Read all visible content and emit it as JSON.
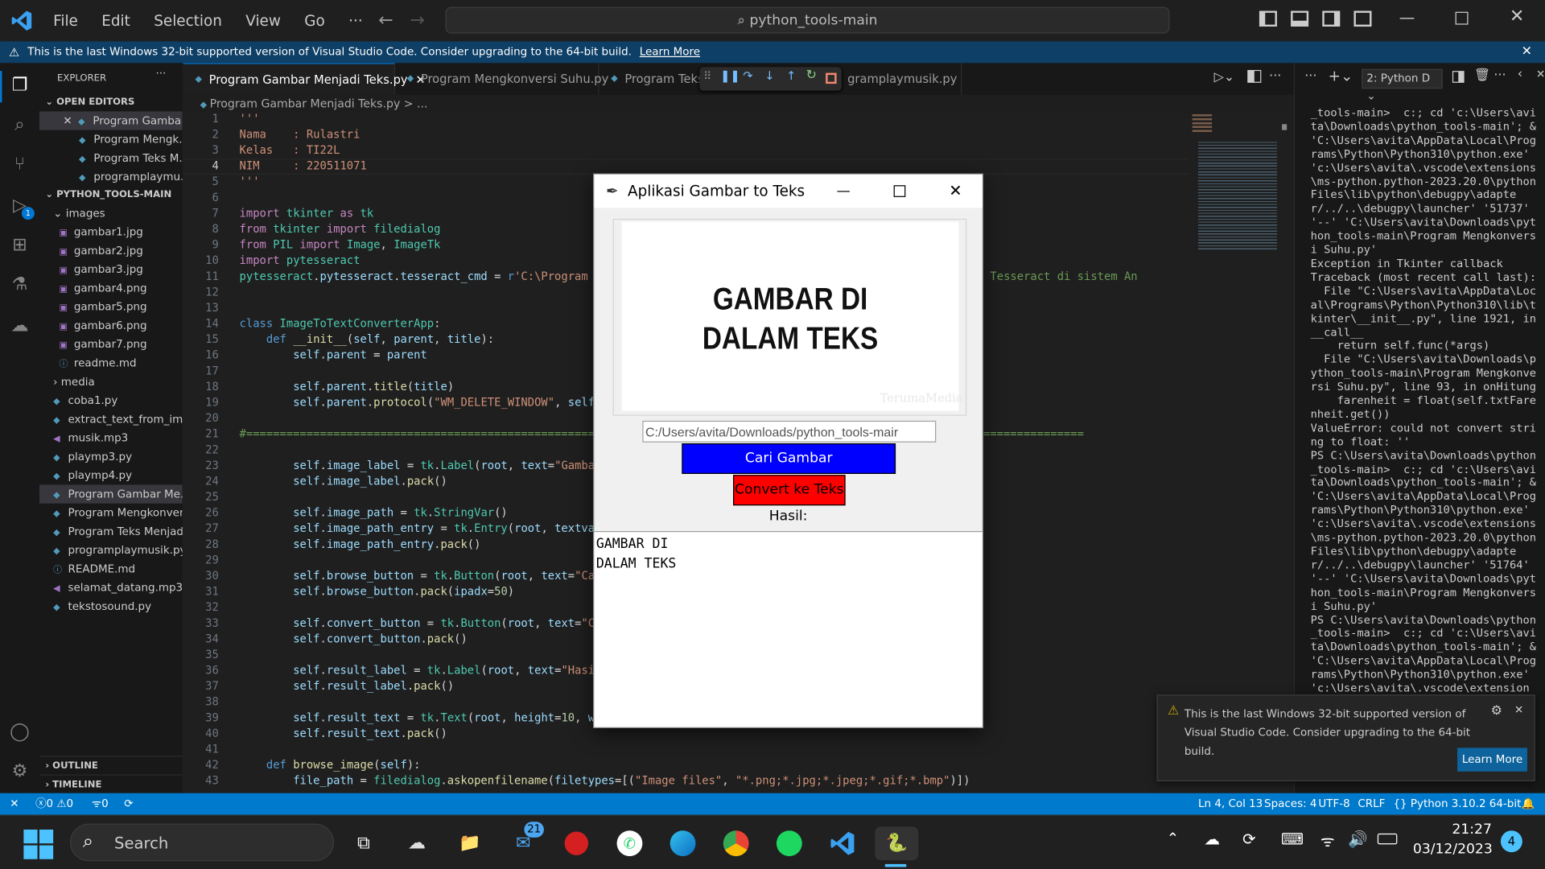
{
  "menu": [
    "File",
    "Edit",
    "Selection",
    "View",
    "Go",
    "···"
  ],
  "search": "python_tools-main",
  "banner": {
    "text": "This is the last Windows 32-bit supported version of Visual Studio Code. Consider upgrading to the 64-bit build.",
    "link": "Learn More"
  },
  "explorer": {
    "title": "EXPLORER",
    "open_editors": "OPEN EDITORS",
    "project": "PYTHON_TOOLS-MAIN",
    "outline": "OUTLINE",
    "timeline": "TIMELINE",
    "open": [
      "Program Gamba...",
      "Program Mengk...",
      "Program Teks M...",
      "programplaymu..."
    ],
    "tree": [
      "images",
      "gambar1.jpg",
      "gambar2.jpg",
      "gambar3.jpg",
      "gambar4.png",
      "gambar5.png",
      "gambar6.png",
      "gambar7.png",
      "readme.md",
      "media",
      "coba1.py",
      "extract_text_from_im...",
      "musik.mp3",
      "playmp3.py",
      "playmp4.py",
      "Program Gambar Me...",
      "Program Mengkonver...",
      "Program Teks Menjad...",
      "programplaymusik.py",
      "README.md",
      "selamat_datang.mp3",
      "tekstosound.py"
    ]
  },
  "tabs": [
    "Program Gambar Menjadi Teks.py",
    "Program Mengkonversi Suhu.py",
    "Program Teks M",
    "gramplaymusik.py"
  ],
  "breadcrumb": "Program Gambar Menjadi Teks.py > ...",
  "line_numbers": [
    "1",
    "2",
    "3",
    "4",
    "5",
    "6",
    "7",
    "8",
    "9",
    "10",
    "11",
    "12",
    "13",
    "14",
    "15",
    "16",
    "17",
    "18",
    "19",
    "20",
    "21",
    "22",
    "23",
    "24",
    "25",
    "26",
    "27",
    "28",
    "29",
    "30",
    "31",
    "32",
    "33",
    "34",
    "35",
    "36",
    "37",
    "38",
    "39",
    "40",
    "41",
    "42",
    "43"
  ],
  "term_selector": "2: Python D",
  "terminal": "_tools-main>  c:; cd 'c:\\Users\\avita\\Downloads\\python_tools-main'; & 'C:\\Users\\avita\\AppData\\Local\\Programs\\Python\\Python310\\python.exe' 'c:\\Users\\avita\\.vscode\\extensions\\ms-python.python-2023.20.0\\pythonFiles\\lib\\python\\debugpy\\adapter/../..\\debugpy\\launcher' '51737' '--' 'C:\\Users\\avita\\Downloads\\python_tools-main\\Program Mengkonversi Suhu.py'\nException in Tkinter callback\nTraceback (most recent call last):\n  File \"C:\\Users\\avita\\AppData\\Local\\Programs\\Python\\Python310\\lib\\tkinter\\__init__.py\", line 1921, in __call__\n    return self.func(*args)\n  File \"C:\\Users\\avita\\Downloads\\python_tools-main\\Program Mengkonversi Suhu.py\", line 93, in onHitung\n    farenheit = float(self.txtFarenheit.get())\nValueError: could not convert string to float: ''\nPS C:\\Users\\avita\\Downloads\\python_tools-main>  c:; cd 'c:\\Users\\avita\\Downloads\\python_tools-main'; & 'C:\\Users\\avita\\AppData\\Local\\Programs\\Python\\Python310\\python.exe' 'c:\\Users\\avita\\.vscode\\extensions\\ms-python.python-2023.20.0\\pythonFiles\\lib\\python\\debugpy\\adapter/../..\\debugpy\\launcher' '51764' '--' 'C:\\Users\\avita\\Downloads\\python_tools-main\\Program Mengkonversi Suhu.py'\nPS C:\\Users\\avita\\Downloads\\python_tools-main>  c:; cd 'c:\\Users\\avita\\Downloads\\python_tools-main'; & 'C:\\Users\\avita\\AppData\\Local\\Programs\\Python\\Python310\\python.exe' 'c:\\Users\\avita\\.vscode\\extension",
  "notification": {
    "text": "This is the last Windows 32-bit supported version of Visual Studio Code. Consider upgrading to the 64-bit build.",
    "button": "Learn More"
  },
  "status": {
    "errors": "0",
    "warnings": "0",
    "ports": "0",
    "position": "Ln 4, Col 13",
    "spaces": "Spaces: 4",
    "encoding": "UTF-8",
    "eol": "CRLF",
    "language": "Python",
    "interpreter": "3.10.2 64-bit"
  },
  "dialog": {
    "title": "Aplikasi Gambar to Teks",
    "image_line1": "GAMBAR DI",
    "image_line2": "DALAM TEKS",
    "watermark": "TerumaMedia",
    "path": "C:/Users/avita/Downloads/python_tools-mair",
    "browse": "Cari Gambar",
    "convert": "Convert ke Teks",
    "result_label": "Hasil:",
    "result_text": "GAMBAR DI\nDALAM TEKS"
  },
  "taskbar": {
    "search": "Search",
    "mail_badge": "21",
    "time": "21:27",
    "date": "03/12/2023",
    "notif_count": "4"
  }
}
